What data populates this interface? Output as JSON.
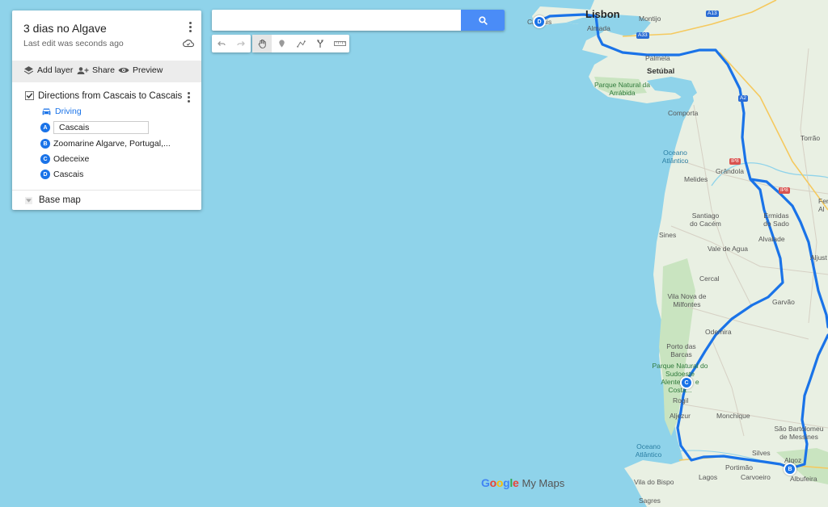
{
  "map_title": "3 dias no Algave",
  "last_edit": "Last edit was seconds ago",
  "actions": {
    "add_layer": "Add layer",
    "share": "Share",
    "preview": "Preview"
  },
  "layer": {
    "name": "Directions from Cascais to Cascais",
    "mode": "Driving",
    "stops": [
      {
        "letter": "A",
        "name": "Cascais"
      },
      {
        "letter": "B",
        "name": "Zoomarine Algarve, Portugal,..."
      },
      {
        "letter": "C",
        "name": "Odeceixe"
      },
      {
        "letter": "D",
        "name": "Cascais"
      }
    ]
  },
  "base_map": "Base map",
  "search": {
    "value": "",
    "placeholder": ""
  },
  "branding": {
    "google": "Google",
    "product": "My Maps"
  },
  "colors": {
    "route": "#1a73e8",
    "accent": "#4a8cf7",
    "land": "#e8f0e0",
    "water": "#8fd3ea"
  },
  "map_labels": {
    "lisbon": "Lisbon",
    "cascais": "Cascais",
    "almada": "Almada",
    "montijo": "Montijo",
    "palmela": "Palmela",
    "setubal": "Setúbal",
    "arrabida": "Parque Natural da Arrábida",
    "comporta": "Comporta",
    "oceano1": "Oceano Atlântico",
    "torrao": "Torrão",
    "melides": "Melides",
    "grandola": "Grândola",
    "santiago": "Santiago do Cacém",
    "ermidas": "Ermidas do Sado",
    "sines": "Sines",
    "alvalade": "Alvalade",
    "fera": "Fer Al",
    "aljust": "Aljust",
    "vale_agua": "Vale de Agua",
    "cercal": "Cercal",
    "milfontes": "Vila Nova de Milfontes",
    "garvao": "Garvão",
    "odemira": "Odemira",
    "porto_barcas": "Porto das Barcas",
    "parque_sudoeste": "Parque Natural do Sudoeste Alentejano e Costa...",
    "rogil": "Rogil",
    "aljezur": "Aljezur",
    "monchique": "Monchique",
    "sao_bartolomeu": "São Bartolomeu de Messines",
    "oceano2": "Oceano Atlântico",
    "silves": "Silves",
    "algoz": "Algoz",
    "portimao": "Portimão",
    "lagos": "Lagos",
    "carvoeiro": "Carvoeiro",
    "albufeira": "Albufeira",
    "vila_bispo": "Vila do Bispo",
    "sagres": "Sagres"
  },
  "shields": {
    "a13": "A13",
    "a33": "A33",
    "a2": "A2",
    "ip8a": "IP8",
    "ip8b": "IP8"
  },
  "markers": {
    "d": "D",
    "c": "C",
    "b": "B"
  }
}
